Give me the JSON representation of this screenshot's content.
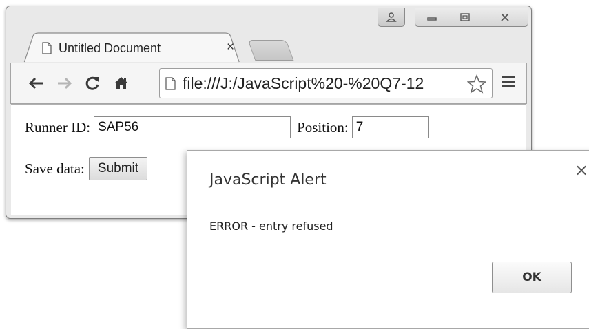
{
  "browser": {
    "tab": {
      "title": "Untitled Document",
      "close_glyph": "×"
    },
    "address_bar": {
      "url": "file:///J:/JavaScript%20-%20Q7-12"
    },
    "icons": {
      "back": "back-arrow-icon",
      "forward": "forward-arrow-icon",
      "reload": "reload-icon",
      "home": "home-icon",
      "page": "page-icon",
      "bookmark": "star-icon",
      "menu": "hamburger-menu-icon",
      "user": "user-icon",
      "minimize": "minimize-icon",
      "maximize": "maximize-icon",
      "close": "close-window-icon"
    }
  },
  "form": {
    "runner_id_label": "Runner ID:",
    "runner_id_value": "SAP56",
    "position_label": "Position:",
    "position_value": "7",
    "save_label": "Save data:",
    "submit_label": "Submit"
  },
  "alert": {
    "title": "JavaScript Alert",
    "close_glyph": "×",
    "message": "ERROR - entry refused",
    "ok_label": "OK"
  }
}
